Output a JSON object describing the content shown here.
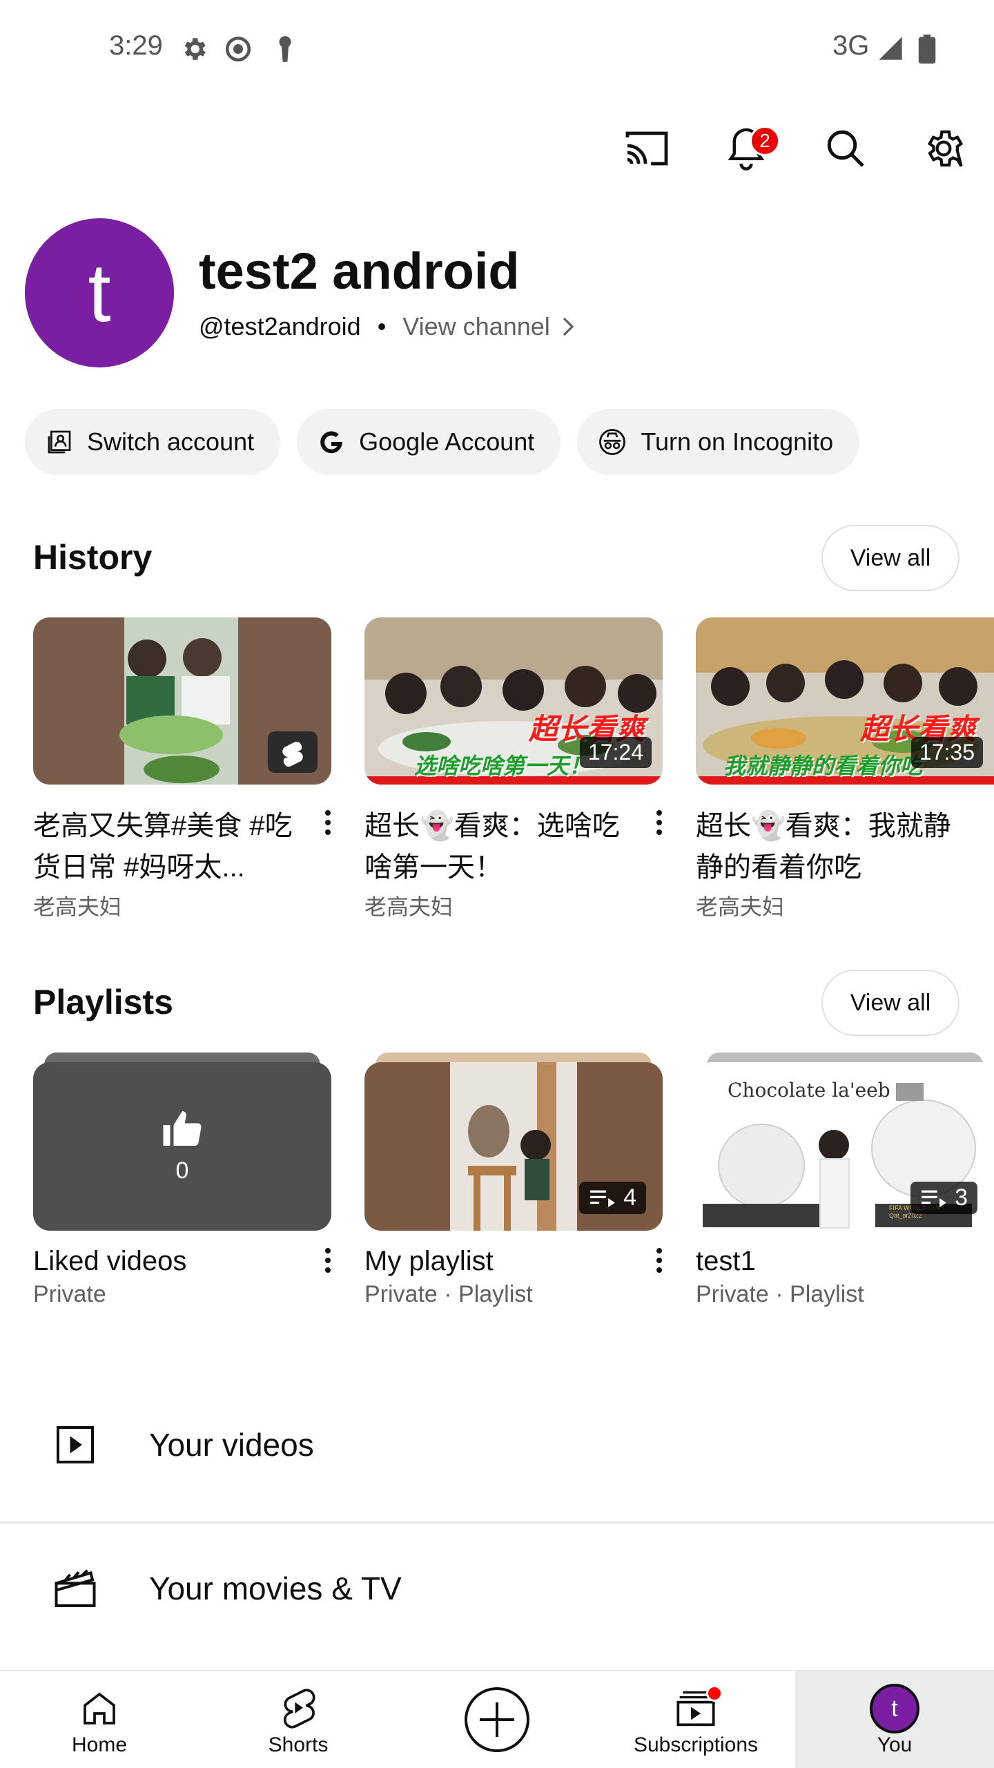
{
  "status_bar": {
    "time": "3:29",
    "network": "3G"
  },
  "top_actions": {
    "notification_count": "2"
  },
  "profile": {
    "avatar_letter": "t",
    "name": "test2 android",
    "handle": "@test2android",
    "separator": "•",
    "view_channel": "View channel"
  },
  "chips": {
    "switch_account": "Switch account",
    "google_account": "Google Account",
    "incognito": "Turn on Incognito"
  },
  "history": {
    "title": "History",
    "view_all": "View all",
    "items": [
      {
        "title": "老高又失算#美食 #吃货日常 #妈呀太...",
        "channel": "老高夫妇",
        "duration": ""
      },
      {
        "title": "超长👻看爽：选啥吃啥第一天！",
        "channel": "老高夫妇",
        "duration": "17:24",
        "overlay_top": "超长看爽",
        "overlay_bottom": "选啥吃啥第一天！"
      },
      {
        "title": "超长👻看爽：我就静静的看着你吃",
        "channel": "老高夫妇",
        "duration": "17:35",
        "overlay_top": "超长看爽",
        "overlay_bottom": "我就静静的看着你吃"
      }
    ]
  },
  "playlists": {
    "title": "Playlists",
    "view_all": "View all",
    "items": [
      {
        "title": "Liked videos",
        "subtitle": "Private",
        "count": "0"
      },
      {
        "title": "My playlist",
        "subtitle": "Private · Playlist",
        "count": "4"
      },
      {
        "title": "test1",
        "subtitle": "Private · Playlist",
        "count": "3",
        "thumb_caption": "Chocolate la'eeb",
        "thumb_small": "FIFA WORLD CUP Qat_ar2022"
      }
    ]
  },
  "list": {
    "your_videos": "Your videos",
    "movies_tv": "Your movies & TV"
  },
  "bottom_nav": {
    "home": "Home",
    "shorts": "Shorts",
    "subscriptions": "Subscriptions",
    "you": "You",
    "you_avatar_letter": "t"
  },
  "colors": {
    "avatar": "#7b1fa2",
    "badge": "#ee0000",
    "accent_red": "#ff0000"
  }
}
